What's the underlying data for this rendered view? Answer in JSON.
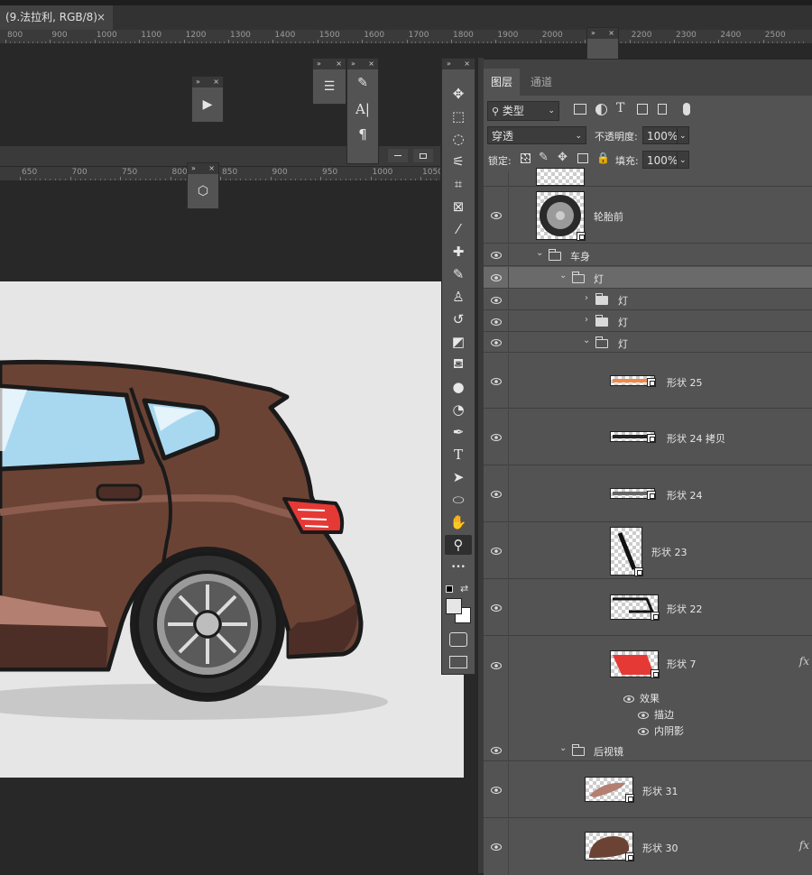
{
  "document": {
    "tab_title": "(9.法拉利, RGB/8)",
    "close_label": "×"
  },
  "rulers": {
    "top": [
      "800",
      "900",
      "1000",
      "1100",
      "1200",
      "1300",
      "1400",
      "1500",
      "1600",
      "1700",
      "1800",
      "1900",
      "2000",
      "2100",
      "2200",
      "2300",
      "2400",
      "2500"
    ],
    "mid": [
      "650",
      "700",
      "750",
      "800",
      "850",
      "900",
      "950",
      "1000",
      "1050"
    ]
  },
  "mini_panels": {
    "header_collapse": "»",
    "header_close": "×"
  },
  "toolbar": {
    "tools": [
      {
        "name": "move-tool",
        "icon": "move-icon",
        "glyph": "✥"
      },
      {
        "name": "marquee-tool",
        "icon": "rect-marquee-icon",
        "glyph": "⬚"
      },
      {
        "name": "lasso-tool",
        "icon": "lasso-icon",
        "glyph": "◌"
      },
      {
        "name": "magic-wand-tool",
        "icon": "magic-wand-icon",
        "glyph": "⚟"
      },
      {
        "name": "crop-tool",
        "icon": "crop-icon",
        "glyph": "⌗"
      },
      {
        "name": "frame-tool",
        "icon": "frame-icon",
        "glyph": "⊠"
      },
      {
        "name": "eyedropper-tool",
        "icon": "eyedropper-icon",
        "glyph": "⁄"
      },
      {
        "name": "healing-tool",
        "icon": "bandage-icon",
        "glyph": "✚"
      },
      {
        "name": "brush-tool",
        "icon": "brush-icon",
        "glyph": "✎"
      },
      {
        "name": "stamp-tool",
        "icon": "stamp-icon",
        "glyph": "♙"
      },
      {
        "name": "history-brush-tool",
        "icon": "history-brush-icon",
        "glyph": "↺"
      },
      {
        "name": "eraser-tool",
        "icon": "eraser-icon",
        "glyph": "◩"
      },
      {
        "name": "bucket-tool",
        "icon": "bucket-icon",
        "glyph": "⛾"
      },
      {
        "name": "blur-tool",
        "icon": "drop-icon",
        "glyph": "●"
      },
      {
        "name": "dodge-tool",
        "icon": "dodge-icon",
        "glyph": "◔"
      },
      {
        "name": "pen-tool",
        "icon": "pen-icon",
        "glyph": "✒"
      },
      {
        "name": "type-tool",
        "icon": "type-icon",
        "glyph": "T"
      },
      {
        "name": "path-select-tool",
        "icon": "arrow-icon",
        "glyph": "➤"
      },
      {
        "name": "ellipse-tool",
        "icon": "ellipse-icon",
        "glyph": "⬭"
      },
      {
        "name": "hand-tool",
        "icon": "hand-icon",
        "glyph": "✋"
      },
      {
        "name": "zoom-tool",
        "icon": "zoom-icon",
        "glyph": "⚲"
      },
      {
        "name": "more-tools",
        "icon": "more-icon",
        "glyph": "•••"
      }
    ]
  },
  "layers_panel": {
    "tabs": [
      "图层",
      "通道"
    ],
    "filter_label": "类型",
    "blend_mode": "穿透",
    "opacity_label": "不透明度:",
    "opacity_value": "100%",
    "lock_label": "锁定:",
    "fill_label": "填充:",
    "fill_value": "100%",
    "layers": [
      {
        "name": "轮胎前"
      },
      {
        "name": "车身"
      },
      {
        "name": "灯"
      },
      {
        "name": "灯"
      },
      {
        "name": "灯"
      },
      {
        "name": "灯"
      },
      {
        "name": "形状 25"
      },
      {
        "name": "形状 24 拷贝"
      },
      {
        "name": "形状 24"
      },
      {
        "name": "形状 23"
      },
      {
        "name": "形状 22"
      },
      {
        "name": "形状 7",
        "fx": "fx"
      },
      {
        "name": "效果"
      },
      {
        "name": "描边"
      },
      {
        "name": "内阴影"
      },
      {
        "name": "后视镜"
      },
      {
        "name": "形状 31"
      },
      {
        "name": "形状 30",
        "fx": "fx"
      }
    ]
  },
  "colors": {
    "car_body": "#6b4335",
    "car_body_dark": "#4d2e26",
    "taillight": "#e53935",
    "window": "#a8d8f0",
    "canvas_bg": "#e6e6e6"
  }
}
